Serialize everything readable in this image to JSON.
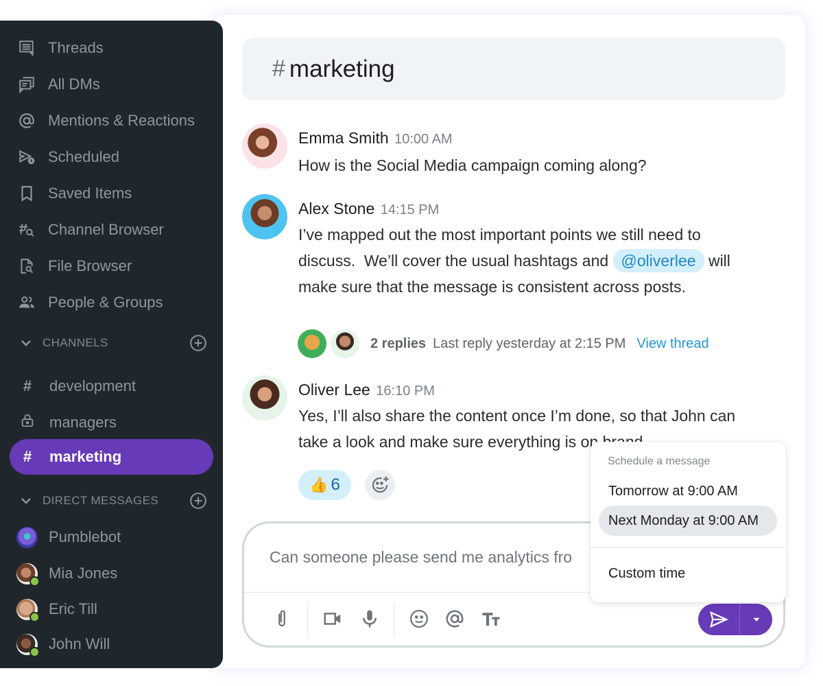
{
  "sidebar": {
    "nav": [
      {
        "label": "Threads",
        "icon": "threads-icon"
      },
      {
        "label": "All DMs",
        "icon": "all-dms-icon"
      },
      {
        "label": "Mentions & Reactions",
        "icon": "at-icon"
      },
      {
        "label": "Scheduled",
        "icon": "scheduled-send-icon"
      },
      {
        "label": "Saved Items",
        "icon": "bookmark-icon"
      },
      {
        "label": "Channel Browser",
        "icon": "channel-search-icon"
      },
      {
        "label": "File Browser",
        "icon": "file-search-icon"
      },
      {
        "label": "People & Groups",
        "icon": "people-icon"
      }
    ],
    "channels_header": "CHANNELS",
    "channels": [
      {
        "label": "development",
        "icon": "#",
        "active": false
      },
      {
        "label": "managers",
        "icon": "lock",
        "active": false
      },
      {
        "label": "marketing",
        "icon": "#",
        "active": true
      }
    ],
    "dm_header": "DIRECT MESSAGES",
    "dms": [
      {
        "label": "Pumblebot",
        "online": false
      },
      {
        "label": "Mia Jones",
        "online": true
      },
      {
        "label": "Eric Till",
        "online": true
      },
      {
        "label": "John Will",
        "online": true
      }
    ]
  },
  "header": {
    "hash": "#",
    "title": "marketing"
  },
  "messages": [
    {
      "author": "Emma Smith",
      "time": "10:00 AM",
      "lines": [
        " How is the Social Media campaign coming along?"
      ]
    },
    {
      "author": "Alex Stone",
      "time": "14:15 PM",
      "line1": "I’ve mapped out the most important points we still need to",
      "line2_pre": "discuss.  We’ll cover the usual hashtags and ",
      "mention": "@oliverlee",
      "line2_post": " will",
      "line3": "make sure that the message is consistent across posts."
    },
    {
      "author": "Oliver Lee",
      "time": "16:10 PM",
      "line1": "Yes, I’ll also share the content once I’m done, so that John can",
      "line2": "take a look and make sure everything is on brand."
    }
  ],
  "thread": {
    "replies": "2 replies",
    "last_reply": "Last reply yesterday at 2:15 PM",
    "view": "View thread"
  },
  "reaction": {
    "emoji": "👍",
    "count": "6"
  },
  "composer": {
    "value": "Can someone please send me analytics fro"
  },
  "schedule_menu": {
    "label": "Schedule a message",
    "options": [
      "Tomorrow at 9:00 AM",
      "Next Monday at 9:00 AM"
    ],
    "highlighted": 1,
    "custom": "Custom time"
  },
  "colors": {
    "accent": "#673ab7",
    "sidebar_bg": "#1f272d",
    "mention_bg": "#d4effc",
    "link": "#2196d6",
    "online": "#8bc34a"
  }
}
